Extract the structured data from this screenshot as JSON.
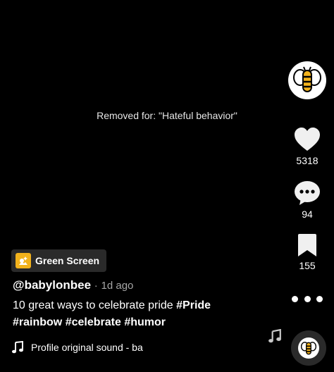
{
  "video": {
    "removed_message": "Removed for: \"Hateful behavior\""
  },
  "rail": {
    "avatar_icon": "babylonbee-bee-logo",
    "likes": "5318",
    "comments": "94",
    "saves": "155",
    "like_icon": "heart-icon",
    "comment_icon": "speech-bubble-icon",
    "save_icon": "bookmark-icon",
    "more_icon": "more-dots-icon"
  },
  "effect": {
    "label": "Green Screen",
    "icon": "green-screen-effect-icon",
    "accent": "#f2b21c"
  },
  "post": {
    "author": "@babylonbee",
    "separator": "·",
    "time": "1d ago",
    "caption_text": "10 great ways to celebrate pride ",
    "hashtags": [
      "#Pride",
      "#rainbow",
      "#celebrate",
      "#humor"
    ]
  },
  "sound": {
    "text": "Profile   original sound - ba",
    "note_icon": "music-note-icon"
  }
}
